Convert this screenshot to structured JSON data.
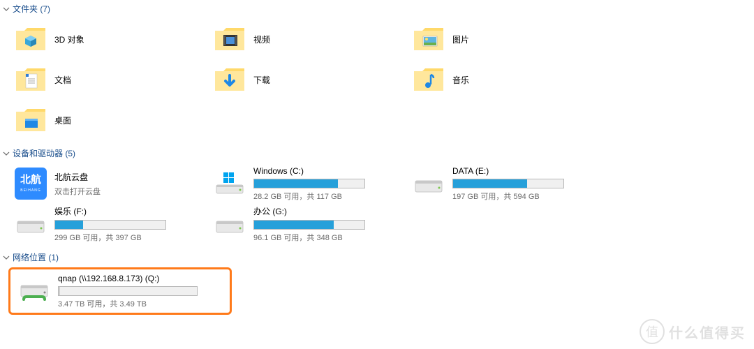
{
  "sections": {
    "folders": {
      "title": "文件夹 (7)"
    },
    "drives": {
      "title": "设备和驱动器 (5)"
    },
    "network": {
      "title": "网络位置 (1)"
    }
  },
  "folders": [
    {
      "name": "3D 对象",
      "icon": "3d"
    },
    {
      "name": "视频",
      "icon": "video"
    },
    {
      "name": "图片",
      "icon": "pictures"
    },
    {
      "name": "文档",
      "icon": "documents"
    },
    {
      "name": "下载",
      "icon": "downloads"
    },
    {
      "name": "音乐",
      "icon": "music"
    },
    {
      "name": "桌面",
      "icon": "desktop"
    }
  ],
  "apps": [
    {
      "name": "北航云盘",
      "sub": "双击打开云盘"
    }
  ],
  "drives": [
    {
      "name": "Windows (C:)",
      "status": "28.2 GB 可用，共 117 GB",
      "fill": 76,
      "system": true
    },
    {
      "name": "DATA (E:)",
      "status": "197 GB 可用，共 594 GB",
      "fill": 67,
      "system": false
    },
    {
      "name": "娱乐 (F:)",
      "status": "299 GB 可用，共 397 GB",
      "fill": 25,
      "system": false
    },
    {
      "name": "办公 (G:)",
      "status": "96.1 GB 可用，共 348 GB",
      "fill": 72,
      "system": false
    }
  ],
  "network": [
    {
      "name": "qnap (\\\\192.168.8.173) (Q:)",
      "status": "3.47 TB 可用，共 3.49 TB",
      "fill": 1
    }
  ],
  "watermark": "什么值得买"
}
